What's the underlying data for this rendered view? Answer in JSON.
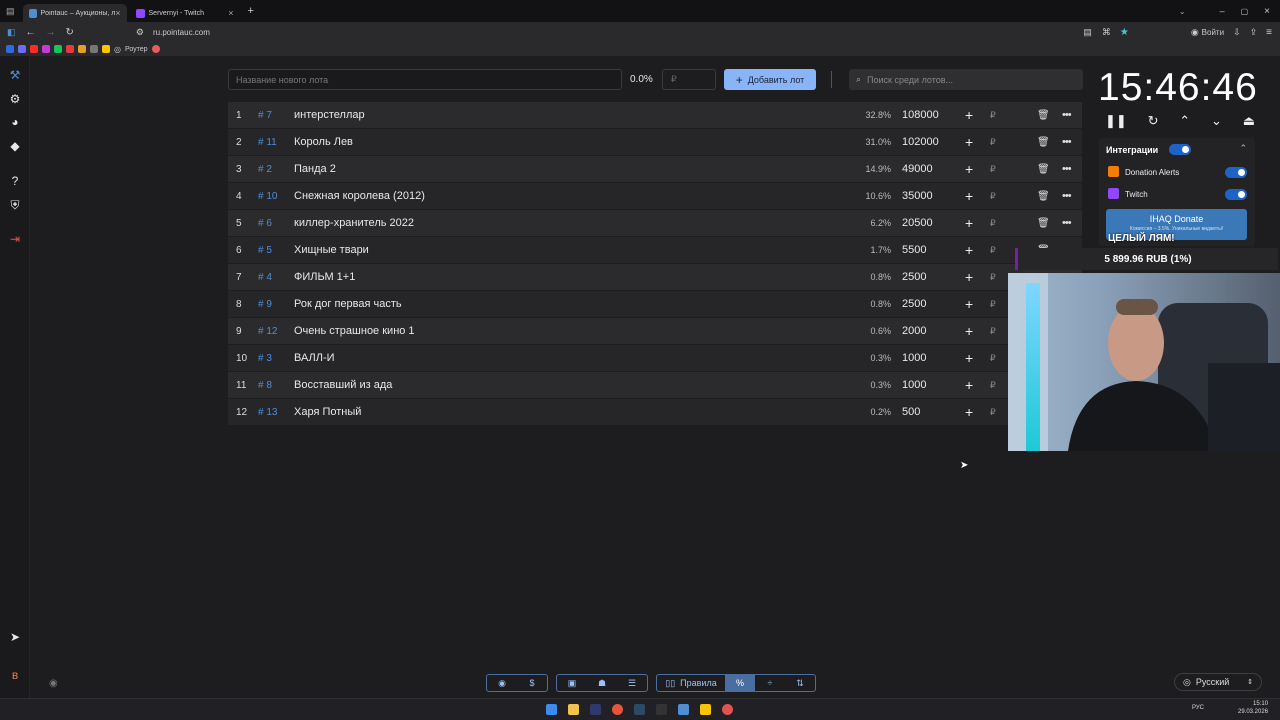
{
  "browser": {
    "tabs": [
      {
        "title": "Pointauc – Аукционы, лотереи",
        "active": true
      },
      {
        "title": "Servernyi - Twitch",
        "active": false
      }
    ],
    "url": "ru.pointauc.com",
    "signin_label": "Войти",
    "bookmark_label": "Роутер"
  },
  "toolbar": {
    "new_lot_placeholder": "Название нового лота",
    "percent": "0.0%",
    "amount_placeholder": "₽",
    "add_lot_label": "Добавить лот",
    "search_placeholder": "Поиск среди лотов..."
  },
  "lots": [
    {
      "rank": "1",
      "id": "# 7",
      "name": "интерстеллар",
      "percent": "32.8%",
      "amount": "108000",
      "currency": "₽"
    },
    {
      "rank": "2",
      "id": "# 11",
      "name": "Король Лев",
      "percent": "31.0%",
      "amount": "102000",
      "currency": "₽"
    },
    {
      "rank": "3",
      "id": "# 2",
      "name": "Панда 2",
      "percent": "14.9%",
      "amount": "49000",
      "currency": "₽"
    },
    {
      "rank": "4",
      "id": "# 10",
      "name": "Снежная королева (2012)",
      "percent": "10.6%",
      "amount": "35000",
      "currency": "₽"
    },
    {
      "rank": "5",
      "id": "# 6",
      "name": "киллер-хранитель 2022",
      "percent": "6.2%",
      "amount": "20500",
      "currency": "₽"
    },
    {
      "rank": "6",
      "id": "# 5",
      "name": "Хищные твари",
      "percent": "1.7%",
      "amount": "5500",
      "currency": "₽"
    },
    {
      "rank": "7",
      "id": "# 4",
      "name": "ФИЛЬМ 1+1",
      "percent": "0.8%",
      "amount": "2500",
      "currency": "₽"
    },
    {
      "rank": "8",
      "id": "# 9",
      "name": "Рок дог первая часть",
      "percent": "0.8%",
      "amount": "2500",
      "currency": "₽"
    },
    {
      "rank": "9",
      "id": "# 12",
      "name": "Очень страшное кино 1",
      "percent": "0.6%",
      "amount": "2000",
      "currency": "₽"
    },
    {
      "rank": "10",
      "id": "# 3",
      "name": "ВАЛЛ-И",
      "percent": "0.3%",
      "amount": "1000",
      "currency": "₽"
    },
    {
      "rank": "11",
      "id": "# 8",
      "name": "Восставший из ада",
      "percent": "0.3%",
      "amount": "1000",
      "currency": "₽"
    },
    {
      "rank": "12",
      "id": "# 13",
      "name": "Харя Потный",
      "percent": "0.2%",
      "amount": "500",
      "currency": "₽"
    }
  ],
  "timer": {
    "time": "15:46:46"
  },
  "integrations": {
    "title": "Интеграции",
    "enabled": true,
    "items": [
      {
        "name": "Donation Alerts",
        "enabled": true
      },
      {
        "name": "Twitch",
        "enabled": true
      }
    ],
    "banner_title": "IHAQ Donate",
    "banner_subtitle": "Комиссия – 3.5%. Уникальные виджеты!"
  },
  "overlay": {
    "title": "ЦЕЛЫЙ ЛЯМ!",
    "donation_progress": "5 899.96 RUB (1%)"
  },
  "bottom_toolbar": {
    "rules_label": "Правила",
    "percent_label": "%"
  },
  "language": {
    "selected": "Русский"
  },
  "taskbar": {
    "lang": "РУС",
    "time": "15:10",
    "date": "29.03.2026"
  },
  "colors": {
    "accent": "#8ab4f8",
    "id_link": "#4f8ed6",
    "toggle_on": "#1e64c8",
    "banner": "#3a78b8",
    "donation_bar_border": "#7b1fa2"
  }
}
